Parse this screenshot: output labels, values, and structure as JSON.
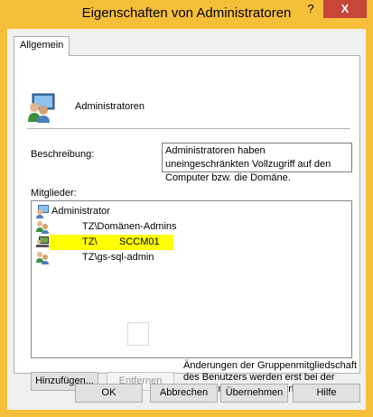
{
  "window": {
    "title": "Eigenschaften von Administratoren",
    "help_glyph": "?",
    "close_glyph": "X"
  },
  "tabs": [
    {
      "label": "Allgemein",
      "selected": true
    }
  ],
  "general": {
    "group_name": "Administratoren",
    "description_label": "Beschreibung:",
    "description_value": "Administratoren haben uneingeschränkten Vollzugriff auf den Computer bzw. die Domäne.",
    "members_label": "Mitglieder:",
    "members": [
      {
        "name": "Administrator",
        "icon": "user-icon"
      },
      {
        "name": "TZ\\Domänen-Admins",
        "icon": "group-icon"
      },
      {
        "name": "TZ\\SCCM01",
        "display_prefix": "TZ\\",
        "display_suffix": "SCCM01",
        "icon": "computer-icon",
        "highlighted": true
      },
      {
        "name": "TZ\\gs-sql-admin",
        "icon": "group-icon"
      }
    ],
    "add_button": "Hinzufügen...",
    "remove_button": "Entfernen",
    "note": "Änderungen der Gruppenmitgliedschaft des Benutzers werden erst bei der nächsten Anmeldung wirksam."
  },
  "footer": {
    "ok": "OK",
    "cancel": "Abbrechen",
    "apply": "Übernehmen",
    "help": "Hilfe"
  },
  "colors": {
    "title_bar": "#f6bf3a",
    "close_button": "#c7463a",
    "highlight": "#ffff00"
  }
}
